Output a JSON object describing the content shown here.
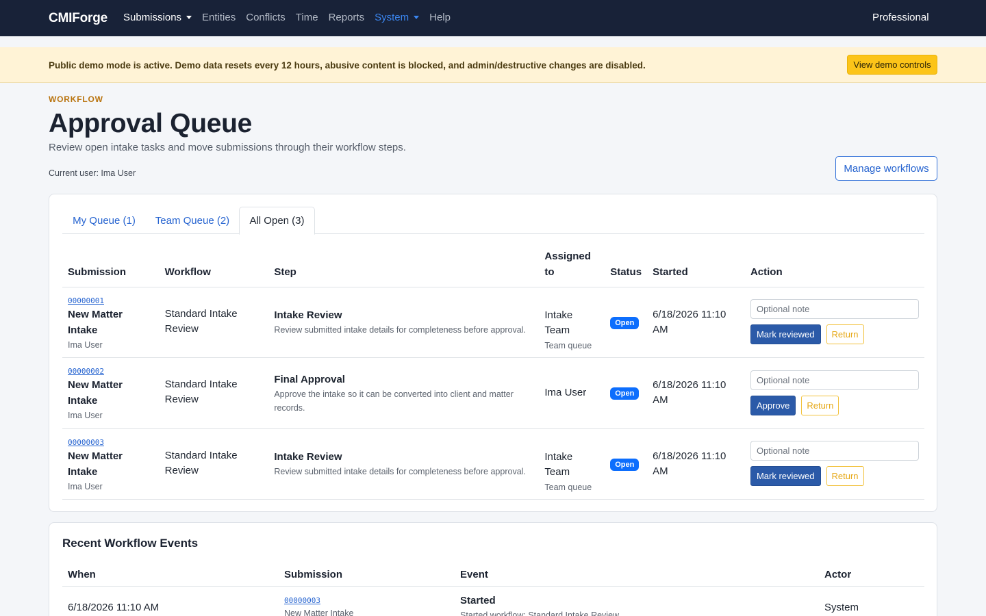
{
  "nav": {
    "brand": "CMIForge",
    "items": [
      {
        "label": "Submissions"
      },
      {
        "label": "Entities"
      },
      {
        "label": "Conflicts"
      },
      {
        "label": "Time"
      },
      {
        "label": "Reports"
      },
      {
        "label": "System"
      },
      {
        "label": "Help"
      }
    ],
    "edition": "Professional"
  },
  "banner": {
    "text": "Public demo mode is active. Demo data resets every 12 hours, abusive content is blocked, and admin/destructive changes are disabled.",
    "button": "View demo controls"
  },
  "header": {
    "eyebrow": "WORKFLOW",
    "title": "Approval Queue",
    "subtitle": "Review open intake tasks and move submissions through their workflow steps.",
    "current_user": "Current user: Ima User",
    "manage_button": "Manage workflows"
  },
  "tabs": [
    {
      "label": "My Queue (1)"
    },
    {
      "label": "Team Queue (2)"
    },
    {
      "label": "All Open (3)"
    }
  ],
  "queue": {
    "columns": [
      "Submission",
      "Workflow",
      "Step",
      "Assigned to",
      "Status",
      "Started",
      "Action"
    ],
    "rows": [
      {
        "id": "00000001",
        "title": "New Matter Intake",
        "submitter": "Ima User",
        "workflow": "Standard Intake Review",
        "step_title": "Intake Review",
        "step_desc": "Review submitted intake details for completeness before approval.",
        "assigned": "Intake Team",
        "assigned_sub": "Team queue",
        "status": "Open",
        "started": "6/18/2026 11:10 AM",
        "note_placeholder": "Optional note",
        "primary_action": "Mark reviewed",
        "return_action": "Return"
      },
      {
        "id": "00000002",
        "title": "New Matter Intake",
        "submitter": "Ima User",
        "workflow": "Standard Intake Review",
        "step_title": "Final Approval",
        "step_desc": "Approve the intake so it can be converted into client and matter records.",
        "assigned": "Ima User",
        "assigned_sub": "",
        "status": "Open",
        "started": "6/18/2026 11:10 AM",
        "note_placeholder": "Optional note",
        "primary_action": "Approve",
        "return_action": "Return"
      },
      {
        "id": "00000003",
        "title": "New Matter Intake",
        "submitter": "Ima User",
        "workflow": "Standard Intake Review",
        "step_title": "Intake Review",
        "step_desc": "Review submitted intake details for completeness before approval.",
        "assigned": "Intake Team",
        "assigned_sub": "Team queue",
        "status": "Open",
        "started": "6/18/2026 11:10 AM",
        "note_placeholder": "Optional note",
        "primary_action": "Mark reviewed",
        "return_action": "Return"
      }
    ]
  },
  "events": {
    "title": "Recent Workflow Events",
    "columns": [
      "When",
      "Submission",
      "Event",
      "Actor"
    ],
    "rows": [
      {
        "when": "6/18/2026 11:10 AM",
        "submission_id": "00000003",
        "submission_title": "New Matter Intake",
        "event_title": "Started",
        "event_desc": "Started workflow: Standard Intake Review",
        "actor": "System"
      }
    ]
  },
  "colors": {
    "navbar": "#182238",
    "accent": "#2563d0",
    "banner": "#fff3d6",
    "warning_button": "#fcc419",
    "badge": "#0d6efd",
    "primary_button": "#2b5aa8"
  }
}
